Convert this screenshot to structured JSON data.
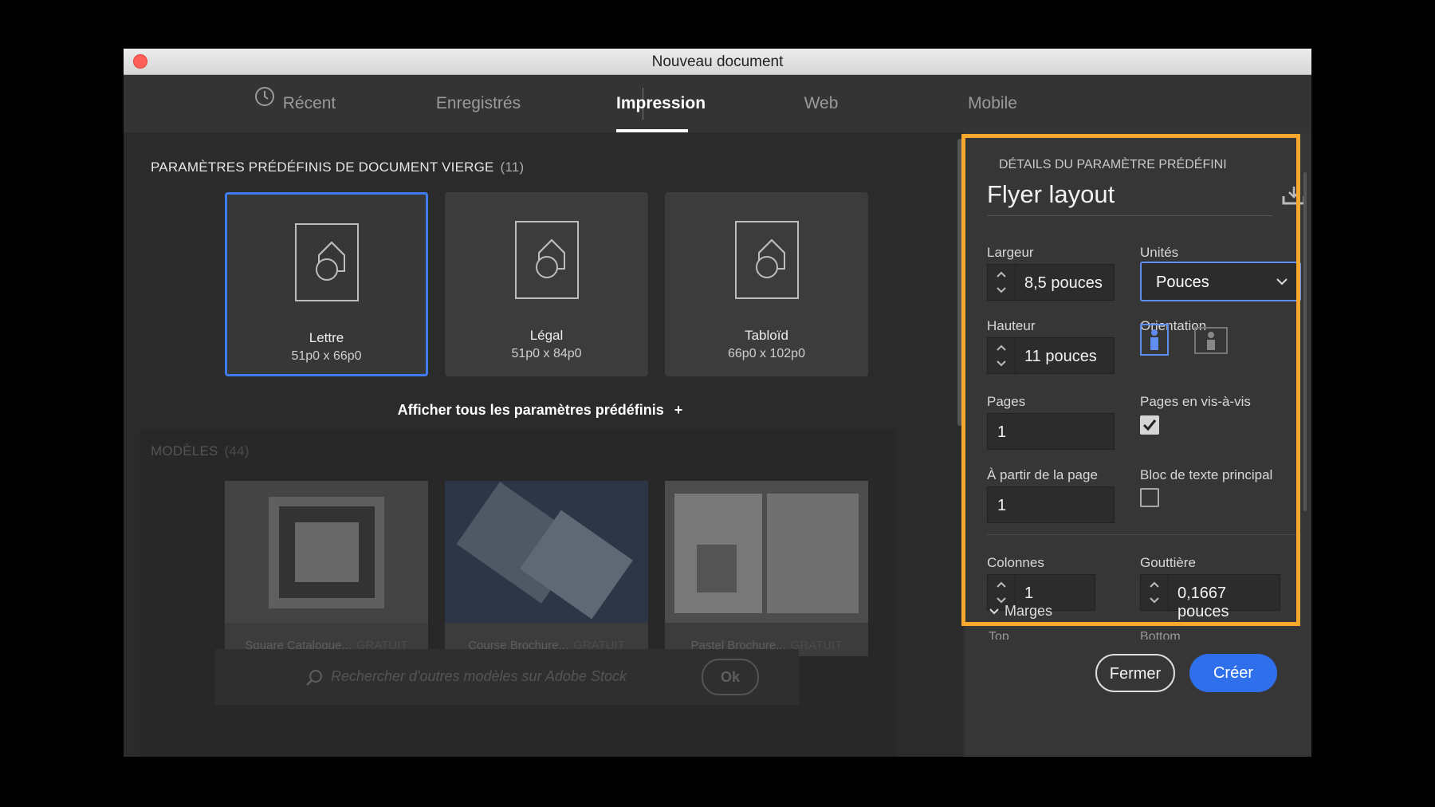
{
  "window": {
    "title": "Nouveau document",
    "close_color": "#ff5f57"
  },
  "tabs": [
    {
      "label": "Récent",
      "icon": "clock-icon"
    },
    {
      "label": "Enregistrés"
    },
    {
      "label": "Impression",
      "active": true
    },
    {
      "label": "Web"
    },
    {
      "label": "Mobile"
    }
  ],
  "blank_presets": {
    "title": "PARAMÈTRES PRÉDÉFINIS DE DOCUMENT VIERGE",
    "count": "(11)",
    "items": [
      {
        "name": "Lettre",
        "size": "51p0 x 66p0",
        "selected": true
      },
      {
        "name": "Légal",
        "size": "51p0 x 84p0"
      },
      {
        "name": "Tabloïd",
        "size": "66p0 x 102p0"
      }
    ],
    "show_all": "Afficher tous les paramètres prédéfinis"
  },
  "templates": {
    "title": "MODÈLES",
    "count": "(44)",
    "items": [
      {
        "name": "Square Catalogue...",
        "badge": "GRATUIT"
      },
      {
        "name": "Course Brochure...",
        "badge": "GRATUIT"
      },
      {
        "name": "Pastel Brochure...",
        "badge": "GRATUIT"
      }
    ],
    "search_placeholder": "Rechercher d'outres modèles sur Adobe Stock",
    "ok_label": "Ok"
  },
  "details": {
    "title": "DÉTAILS DU PARAMÈTRE PRÉDÉFINI",
    "preset_name": "Flyer layout",
    "width_label": "Largeur",
    "width_value": "8,5 pouces",
    "units_label": "Unités",
    "units_value": "Pouces",
    "height_label": "Hauteur",
    "height_value": "11 pouces",
    "orientation_label": "Orientation",
    "pages_label": "Pages",
    "pages_value": "1",
    "facing_label": "Pages en vis-à-vis",
    "facing_checked": true,
    "start_label": "À partir de la page",
    "start_value": "1",
    "primary_label": "Bloc de texte principal",
    "primary_checked": false,
    "columns_label": "Colonnes",
    "columns_value": "1",
    "gutter_label": "Gouttière",
    "gutter_value": "0,1667 pouces",
    "margins_label": "Marges",
    "margins_top_label": "Top",
    "margins_bottom_label": "Bottom"
  },
  "footer": {
    "close_label": "Fermer",
    "create_label": "Créer"
  },
  "colors": {
    "accent": "#2f6fec",
    "highlight": "#f7a82d",
    "selection": "#3f7cf2"
  }
}
